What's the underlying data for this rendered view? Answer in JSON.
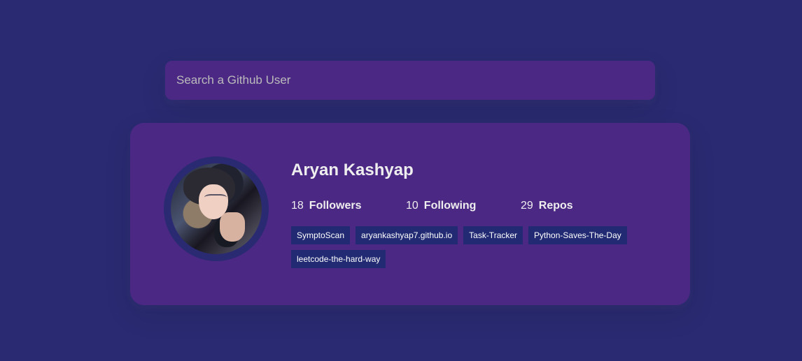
{
  "search": {
    "placeholder": "Search a Github User"
  },
  "profile": {
    "name": "Aryan Kashyap",
    "stats": {
      "followers": {
        "count": "18",
        "label": "Followers"
      },
      "following": {
        "count": "10",
        "label": "Following"
      },
      "repos": {
        "count": "29",
        "label": "Repos"
      }
    },
    "repos": [
      "SymptoScan",
      "aryankashyap7.github.io",
      "Task-Tracker",
      "Python-Saves-The-Day",
      "leetcode-the-hard-way"
    ]
  },
  "colors": {
    "background": "#2a2a72",
    "card": "#4c2885",
    "repo_badge": "#212a72",
    "text": "#eeeeee"
  }
}
